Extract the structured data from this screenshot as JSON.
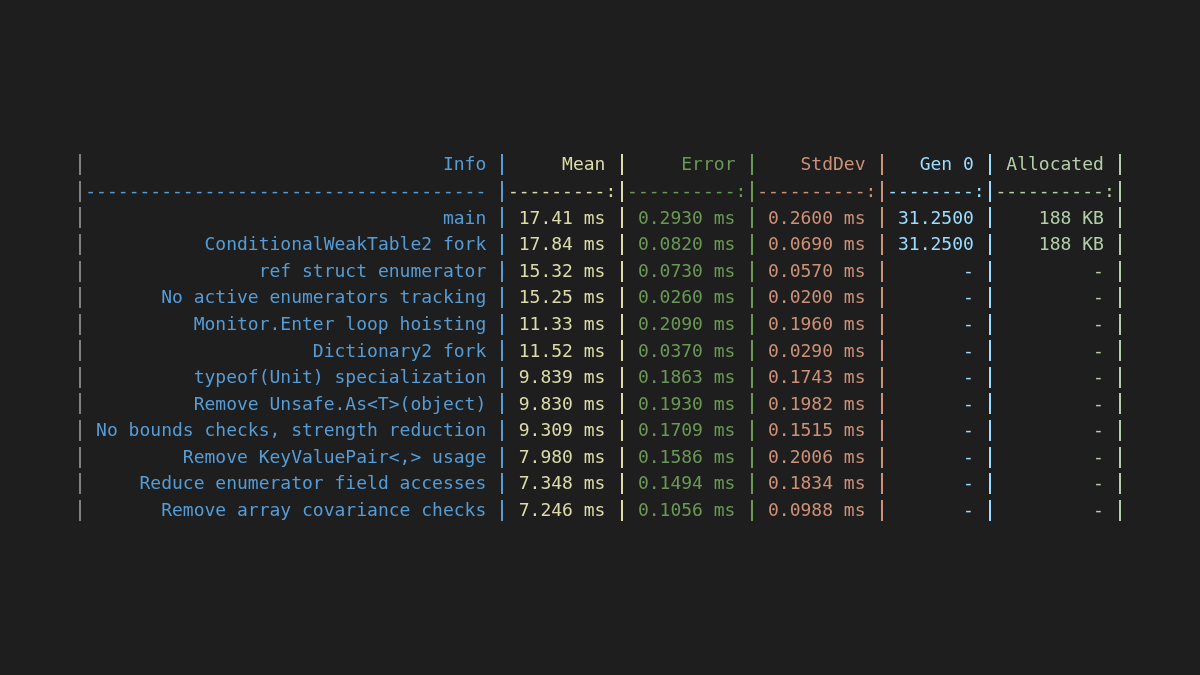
{
  "table": {
    "columns": [
      {
        "header": "Info",
        "separator": "-------------------------------------",
        "color": "#569cd6"
      },
      {
        "header": "Mean",
        "separator": "---------:",
        "color": "#dcdcaa"
      },
      {
        "header": "Error",
        "separator": "----------:",
        "color": "#6a9955"
      },
      {
        "header": "StdDev",
        "separator": "----------:",
        "color": "#ce9178"
      },
      {
        "header": "Gen 0",
        "separator": "--------:",
        "color": "#9cdcfe"
      },
      {
        "header": "Allocated",
        "separator": "----------:",
        "color": "#b5cea8"
      }
    ],
    "rows": [
      [
        "main",
        "17.41 ms",
        "0.2930 ms",
        "0.2600 ms",
        "31.2500",
        "188 KB"
      ],
      [
        "ConditionalWeakTable2 fork",
        "17.84 ms",
        "0.0820 ms",
        "0.0690 ms",
        "31.2500",
        "188 KB"
      ],
      [
        "ref struct enumerator",
        "15.32 ms",
        "0.0730 ms",
        "0.0570 ms",
        "-",
        "-"
      ],
      [
        "No active enumerators tracking",
        "15.25 ms",
        "0.0260 ms",
        "0.0200 ms",
        "-",
        "-"
      ],
      [
        "Monitor.Enter loop hoisting",
        "11.33 ms",
        "0.2090 ms",
        "0.1960 ms",
        "-",
        "-"
      ],
      [
        "Dictionary2 fork",
        "11.52 ms",
        "0.0370 ms",
        "0.0290 ms",
        "-",
        "-"
      ],
      [
        "typeof(Unit) specialization",
        "9.839 ms",
        "0.1863 ms",
        "0.1743 ms",
        "-",
        "-"
      ],
      [
        "Remove Unsafe.As<T>(object)",
        "9.830 ms",
        "0.1930 ms",
        "0.1982 ms",
        "-",
        "-"
      ],
      [
        "No bounds checks, strength reduction",
        "9.309 ms",
        "0.1709 ms",
        "0.1515 ms",
        "-",
        "-"
      ],
      [
        "Remove KeyValuePair<,> usage",
        "7.980 ms",
        "0.1586 ms",
        "0.2006 ms",
        "-",
        "-"
      ],
      [
        "Reduce enumerator field accesses",
        "7.348 ms",
        "0.1494 ms",
        "0.1834 ms",
        "-",
        "-"
      ],
      [
        "Remove array covariance checks",
        "7.246 ms",
        "0.1056 ms",
        "0.0988 ms",
        "-",
        "-"
      ]
    ]
  }
}
